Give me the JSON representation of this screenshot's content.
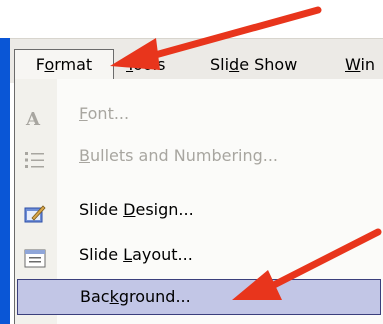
{
  "menubar": {
    "menus": [
      {
        "label_pre": "F",
        "label_u": "o",
        "label_post": "rmat"
      },
      {
        "label_pre": "",
        "label_u": "T",
        "label_post": "ools"
      },
      {
        "label_pre": "Sli",
        "label_u": "d",
        "label_post": "e Show"
      },
      {
        "label_pre": "",
        "label_u": "W",
        "label_post": "in"
      }
    ]
  },
  "format_menu": {
    "items": [
      {
        "label_pre": "",
        "label_u": "F",
        "label_post": "ont...",
        "icon": "font-A-icon",
        "enabled": false
      },
      {
        "label_pre": "",
        "label_u": "B",
        "label_post": "ullets and Numbering...",
        "icon": "bullets-list-icon",
        "enabled": false
      },
      {
        "label_pre": "Slide ",
        "label_u": "D",
        "label_post": "esign...",
        "icon": "slide-design-icon",
        "enabled": true
      },
      {
        "label_pre": "Slide ",
        "label_u": "L",
        "label_post": "ayout...",
        "icon": "slide-layout-icon",
        "enabled": true
      },
      {
        "label_pre": "Bac",
        "label_u": "k",
        "label_post": "ground...",
        "icon": "",
        "enabled": true,
        "highlighted": true
      }
    ]
  },
  "colors": {
    "arrow": "#e8351c",
    "highlight": "#c2c6e6",
    "menubar": "#eceae6"
  }
}
